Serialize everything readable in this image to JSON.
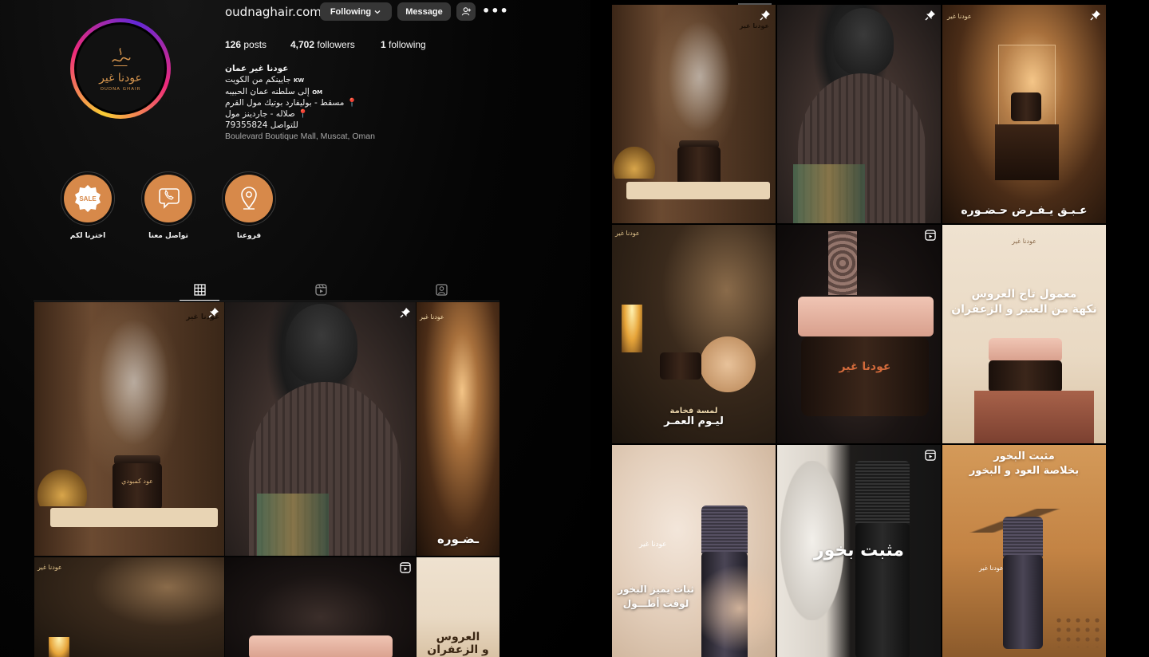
{
  "profile": {
    "username": "oudnaghair.com",
    "following_button": "Following",
    "message_button": "Message",
    "more_glyph": "•••",
    "avatar_logo_ar": "عودنا غير",
    "avatar_logo_en": "OUDNA GHAIR",
    "stats": {
      "posts_count": "126",
      "posts_label": "posts",
      "followers_count": "4,702",
      "followers_label": "followers",
      "following_count": "1",
      "following_label": "following"
    },
    "bio": {
      "name": "عودنا غير عمان",
      "line1": "جايينكم من الكويت",
      "line1_flag": "KW",
      "line2": "إلى سلطنه عمان الحبيبه",
      "line2_flag": "OM",
      "line3": "مسقط - بوليفارد بوتيك مول القرم 📍",
      "line4": "صلاله - جاردينز مول 📍",
      "line5": "79355824 للتواصل",
      "location": "Boulevard Boutique Mall, Muscat, Oman"
    }
  },
  "highlights": [
    {
      "label": "اخترنا لكم",
      "badge": "SALE",
      "icon": "sale-badge-icon"
    },
    {
      "label": "تواصل معنا",
      "icon": "phone-chat-icon"
    },
    {
      "label": "فروعنا",
      "icon": "location-pin-icon"
    }
  ],
  "tabs": [
    {
      "name": "posts",
      "icon": "grid-icon"
    },
    {
      "name": "reels",
      "icon": "reels-icon"
    },
    {
      "name": "tagged",
      "icon": "tagged-user-icon"
    }
  ],
  "right_grid": [
    {
      "caption": "",
      "badge": "pin",
      "logo": "عودنا غير"
    },
    {
      "caption": "",
      "badge": "pin"
    },
    {
      "caption": "عـبـق يـفـرض حـضـوره",
      "badge": "pin",
      "logo": "عودنا غير"
    },
    {
      "caption": "لمسة فخامة",
      "caption2": "ليـوم العمـر",
      "logo": "عودنا غير"
    },
    {
      "caption": "",
      "badge": "reel",
      "jar_text": "عودنا غير"
    },
    {
      "caption": "معمول تاج العروس",
      "caption2": "نكهة من العنبر و الزعفران",
      "logo": "عودنا غير"
    },
    {
      "caption": "ثبات يميز البخور",
      "caption2": "لوقت أطـــول",
      "logo": "عودنا غير"
    },
    {
      "caption": "مثبت بخور",
      "badge": "reel"
    },
    {
      "caption": "مثبت البخور",
      "caption2": "بخلاصة العود و البخور",
      "logo": "عودنا غير"
    }
  ],
  "left_grid": [
    {
      "caption": "",
      "badge": "pin",
      "logo": "عودنا غير",
      "jar_text": "عود كمبودي"
    },
    {
      "caption": "",
      "badge": "pin"
    },
    {
      "caption": "ـضـوره",
      "logo": "عودنا غير"
    },
    {
      "caption": "",
      "logo": "عودنا غير"
    },
    {
      "caption": "",
      "badge": "reel"
    },
    {
      "caption": "العروس",
      "caption2": "و الزعفران"
    }
  ]
}
